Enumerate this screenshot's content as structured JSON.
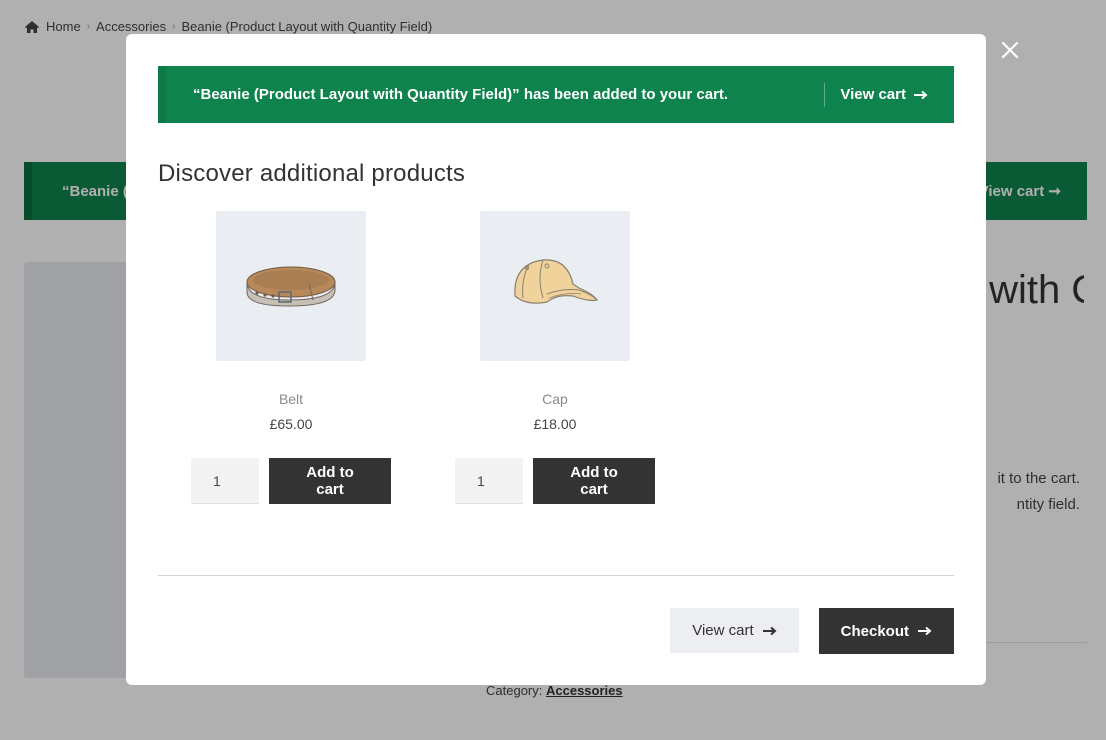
{
  "background_page": {
    "breadcrumb": [
      {
        "label": "Home",
        "icon": "home-icon"
      },
      {
        "label": "Accessories"
      },
      {
        "label": "Beanie (Product Layout with Quantity Field)"
      }
    ],
    "notice": {
      "text": "“Beanie (Product Layout with Quantity Field)” has been added to your cart.",
      "link_label": "View cart"
    },
    "product_title": "Beanie (Product Layout with Quantity",
    "description_lines": [
      "it to the cart.",
      "ntity field."
    ],
    "category_label": "Category:",
    "category_link": "Accessories"
  },
  "modal": {
    "notice": {
      "text": "“Beanie (Product Layout with Quantity Field)” has been added to your cart.",
      "link_label": "View cart",
      "link_icon": "arrow-right-icon"
    },
    "section_title": "Discover additional products",
    "products": [
      {
        "name": "Belt",
        "price": "£65.00",
        "quantity": "1",
        "button_label": "Add to cart",
        "image": "belt-image"
      },
      {
        "name": "Cap",
        "price": "£18.00",
        "quantity": "1",
        "button_label": "Add to cart",
        "image": "cap-image"
      }
    ],
    "footer": {
      "view_cart_label": "View cart",
      "checkout_label": "Checkout"
    }
  },
  "colors": {
    "notice_green": "#0f834d",
    "dark_button": "#333333",
    "light_button": "#eceef1",
    "image_bg": "#eaedf1"
  }
}
